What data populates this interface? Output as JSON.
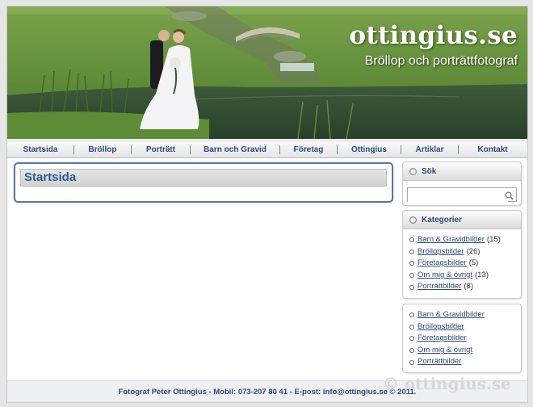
{
  "header": {
    "site_title": "ottingius.se",
    "tagline": "Bröllop och porträttfotograf"
  },
  "nav": {
    "items": [
      {
        "label": "Startsida"
      },
      {
        "label": "Bröllop"
      },
      {
        "label": "Porträtt"
      },
      {
        "label": "Barn och Gravid"
      },
      {
        "label": "Företag"
      },
      {
        "label": "Ottingius"
      },
      {
        "label": "Artiklar"
      },
      {
        "label": "Kontakt"
      }
    ]
  },
  "main": {
    "title": "Startsida"
  },
  "sidebar": {
    "search": {
      "title": "Sök",
      "value": ""
    },
    "categories": {
      "title": "Kategorier",
      "items": [
        {
          "label": "Barn & Gravidbilder",
          "count": "(15)"
        },
        {
          "label": "Bröllopsbilder",
          "count": "(26)"
        },
        {
          "label": "Företagsbilder",
          "count": "(5)"
        },
        {
          "label": "Om mig & övrigt",
          "count": "(13)"
        },
        {
          "label": "Porträttbilder",
          "count": "(8)"
        }
      ]
    },
    "links": {
      "items": [
        {
          "label": "Barn & Gravidbilder"
        },
        {
          "label": "Bröllopsbilder"
        },
        {
          "label": "Företagsbilder"
        },
        {
          "label": "Om mig & övrigt"
        },
        {
          "label": "Porträttbilder"
        }
      ]
    }
  },
  "footer": {
    "text": "Fotograf Peter Ottingius - Mobil: 073-207 80 41 - E-post: info@ottingius.se © 2011."
  },
  "watermark": "© ottingius.se",
  "colors": {
    "link": "#2e4a78",
    "title_blue": "#2a5a96",
    "box_border": "#5a789f"
  }
}
